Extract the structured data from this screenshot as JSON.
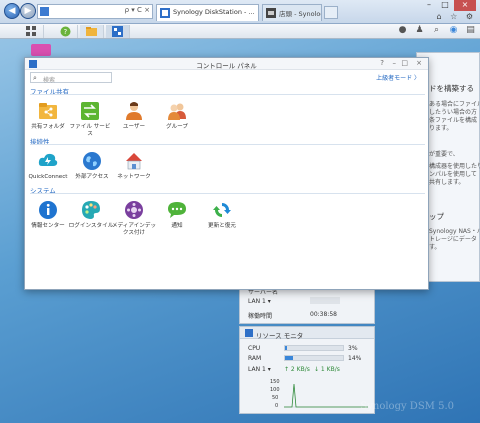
{
  "browser": {
    "address_placeholder": "",
    "address_tools": "ρ ▾ C ×",
    "tabs": [
      {
        "label": "Synology DiskStation - ...",
        "close": "×"
      },
      {
        "label": "店頭 - Synology について  -",
        "close": "×"
      }
    ],
    "window_controls": {
      "minimize": "–",
      "maximize": "□",
      "close": "×"
    },
    "right_icons": "⌂ ☆ ⚙"
  },
  "dsm_taskbar": {
    "right_icons": [
      "chat-icon",
      "user-icon",
      "search-icon",
      "widget-icon",
      "panel-icon"
    ]
  },
  "background_window": {
    "heading": "ドを構築する",
    "lines": [
      "ある場合にファイルに",
      "したうい場合の方",
      "条ファイルを構成",
      "ります。",
      "が重要で、",
      "構成器を使用したり・数",
      "ンパルを使用して",
      "共有します。",
      "ップ",
      "Synology NAS・パ",
      "トレージにデータ",
      "す。"
    ]
  },
  "system_widget": {
    "lan_label": "LAN 1 ▾",
    "uptime_label": "稼働時間",
    "uptime_value": "00:38:58",
    "header_partial": "サーバー名"
  },
  "resource_monitor": {
    "title": "リソース モニタ",
    "cpu_label": "CPU",
    "cpu_value": "3%",
    "cpu_fraction": 0.03,
    "ram_label": "RAM",
    "ram_value": "14%",
    "ram_fraction": 0.14,
    "lan_label": "LAN 1 ▾",
    "upload": "↑ 2 KB/s",
    "download": "↓ 1 KB/s",
    "axis_ticks": [
      "150",
      "100",
      "50",
      "0"
    ]
  },
  "watermark": "Synology DSM 5.0",
  "control_panel": {
    "title": "コントロール パネル",
    "search_placeholder": "検索",
    "advanced_mode": "上級者モード 〉",
    "window_controls": {
      "help": "?",
      "minimize": "–",
      "maximize": "□",
      "close": "×"
    },
    "sections": [
      {
        "title": "ファイル共有",
        "items": [
          {
            "label": "共有フォルダ",
            "icon": "shared-folder-icon"
          },
          {
            "label": "ファイル サービス",
            "icon": "file-services-icon"
          },
          {
            "label": "ユーザー",
            "icon": "user-icon"
          },
          {
            "label": "グループ",
            "icon": "group-icon"
          }
        ]
      },
      {
        "title": "接続性",
        "items": [
          {
            "label": "QuickConnect",
            "icon": "quickconnect-icon"
          },
          {
            "label": "外部アクセス",
            "icon": "external-access-icon"
          },
          {
            "label": "ネットワーク",
            "icon": "network-icon"
          }
        ]
      },
      {
        "title": "システム",
        "items": [
          {
            "label": "情報センター",
            "icon": "info-center-icon"
          },
          {
            "label": "ログインスタイル",
            "icon": "login-style-icon"
          },
          {
            "label": "メディアインデックス付け",
            "icon": "media-indexing-icon"
          },
          {
            "label": "通知",
            "icon": "notification-icon"
          },
          {
            "label": "更新と復元",
            "icon": "update-restore-icon"
          }
        ]
      }
    ]
  }
}
